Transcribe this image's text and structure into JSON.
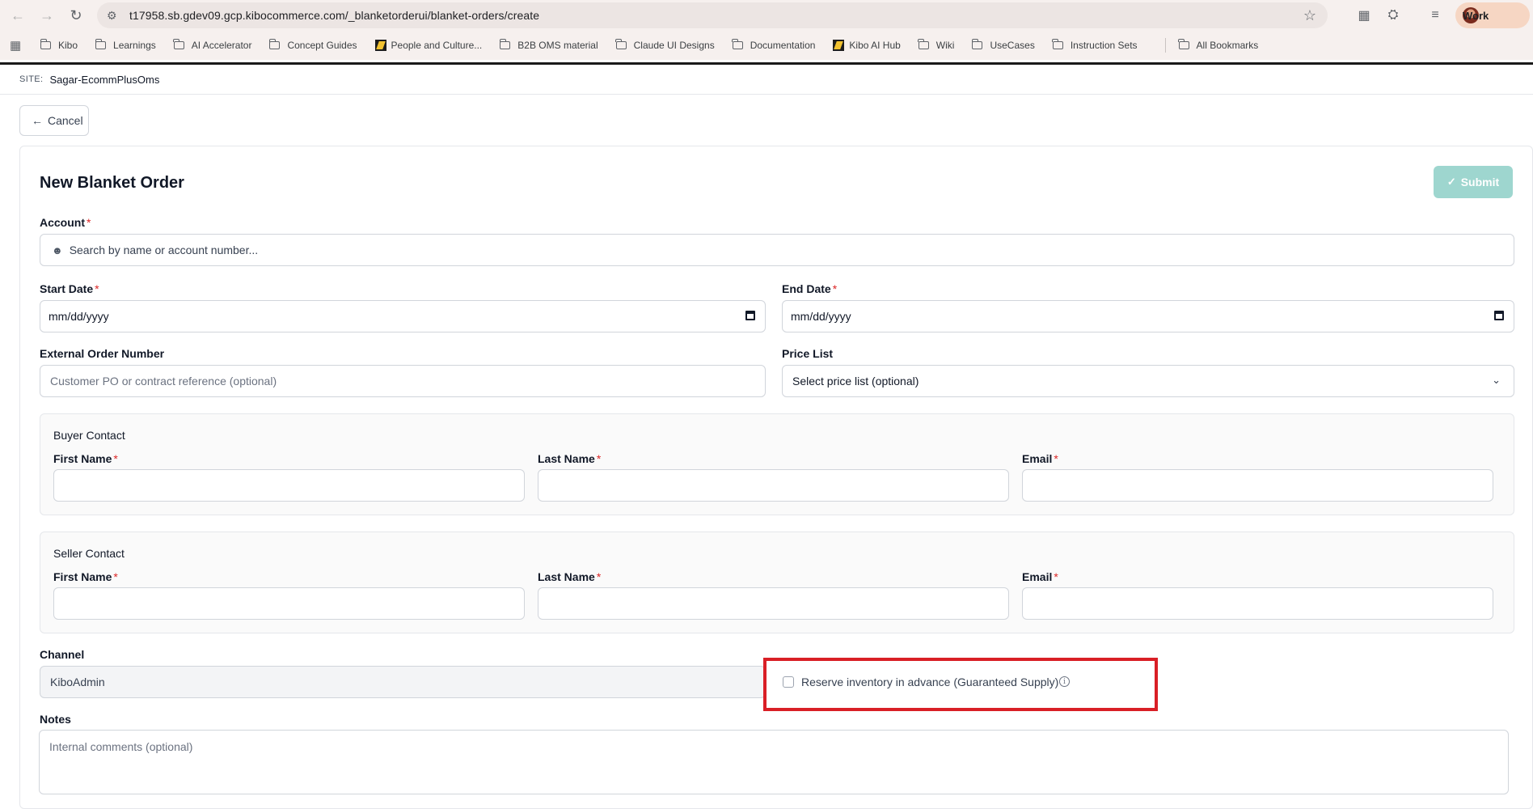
{
  "browser": {
    "url": "t17958.sb.gdev09.gcp.kibocommerce.com/_blanketorderui/blanket-orders/create",
    "profile_label": "Work",
    "bookmarks": [
      {
        "label": "Kibo",
        "icon": "folder-icon"
      },
      {
        "label": "Learnings",
        "icon": "folder-icon"
      },
      {
        "label": "AI Accelerator",
        "icon": "folder-icon"
      },
      {
        "label": "Concept Guides",
        "icon": "folder-icon"
      },
      {
        "label": "People and Culture...",
        "icon": "kibo-logo-icon"
      },
      {
        "label": "B2B OMS material",
        "icon": "folder-icon"
      },
      {
        "label": "Claude UI Designs",
        "icon": "folder-icon"
      },
      {
        "label": "Documentation",
        "icon": "folder-icon"
      },
      {
        "label": "Kibo AI Hub",
        "icon": "kibo-logo-icon"
      },
      {
        "label": "Wiki",
        "icon": "folder-icon"
      },
      {
        "label": "UseCases",
        "icon": "folder-icon"
      },
      {
        "label": "Instruction Sets",
        "icon": "folder-icon"
      }
    ],
    "all_bookmarks_label": "All Bookmarks"
  },
  "site": {
    "label": "SITE:",
    "value": "Sagar-EcommPlusOms"
  },
  "cancel_label": "Cancel",
  "form": {
    "title": "New Blanket Order",
    "submit_label": "Submit",
    "account": {
      "label": "Account",
      "placeholder": "Search by name or account number..."
    },
    "start_date": {
      "label": "Start Date",
      "value": "mm/dd/yyyy"
    },
    "end_date": {
      "label": "End Date",
      "value": "mm/dd/yyyy"
    },
    "external_order": {
      "label": "External Order Number",
      "placeholder": "Customer PO or contract reference (optional)"
    },
    "price_list": {
      "label": "Price List",
      "value": "Select price list (optional)"
    },
    "buyer_contact": {
      "title": "Buyer Contact",
      "first_name": "First Name",
      "last_name": "Last Name",
      "email": "Email"
    },
    "seller_contact": {
      "title": "Seller Contact",
      "first_name": "First Name",
      "last_name": "Last Name",
      "email": "Email"
    },
    "channel": {
      "label": "Channel",
      "value": "KiboAdmin"
    },
    "reserve_inventory": {
      "label": "Reserve inventory in advance (Guaranteed Supply)",
      "checked": false
    },
    "notes": {
      "label": "Notes",
      "placeholder": "Internal comments (optional)"
    },
    "required_mark": "*"
  },
  "colors": {
    "submit_disabled": "#9ed6cf",
    "highlight_box": "#d91f26",
    "required": "#dc2626"
  }
}
